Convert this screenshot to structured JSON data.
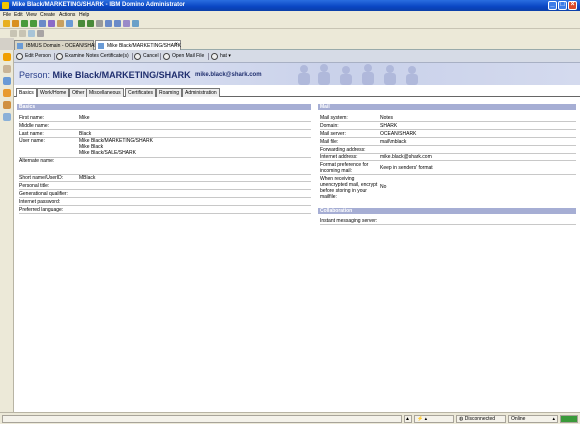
{
  "window": {
    "title": "Mike Black/MARKETING/SHARK - IBM Domino Administrator"
  },
  "menu": [
    "File",
    "Edit",
    "View",
    "Create",
    "Actions",
    "Help"
  ],
  "tabs": [
    {
      "label": "IBMUS Domain - OCEAN/SHARK",
      "active": false
    },
    {
      "label": "Mike Black/MARKETING/SHARK",
      "active": true
    }
  ],
  "actions": {
    "edit": "Edit Person",
    "examine": "Examine Notes Certificate(s)",
    "cancel": "Cancel",
    "openmail": "Open Mail File",
    "more": "hat"
  },
  "person": {
    "prefix": "Person:",
    "name": "Mike Black/MARKETING/SHARK",
    "email": "mike.black@shark.com"
  },
  "form_tabs": [
    "Basics",
    "Work/Home",
    "Other",
    "Miscellaneous",
    "Certificates",
    "Roaming",
    "Administration"
  ],
  "basics": {
    "title": "Basics",
    "first_name": {
      "label": "First name:",
      "value": "Mike"
    },
    "middle_name": {
      "label": "Middle name:",
      "value": ""
    },
    "last_name": {
      "label": "Last name:",
      "value": "Black"
    },
    "user_name": {
      "label": "User name:",
      "values": [
        "Mike Black/MARKETING/SHARK",
        "Mike Black",
        "Mike Black/SALE/SHARK"
      ]
    },
    "alternate_name": {
      "label": "Alternate name:",
      "value": ""
    },
    "short_name": {
      "label": "Short name/UserID:",
      "value": "MBlack"
    },
    "personal_title": {
      "label": "Personal title:",
      "value": ""
    },
    "generational": {
      "label": "Generational qualifier:",
      "value": ""
    },
    "internet_password": {
      "label": "Internet password:",
      "value": ""
    },
    "preferred_language": {
      "label": "Preferred language:",
      "value": ""
    }
  },
  "mail": {
    "title": "Mail",
    "mail_system": {
      "label": "Mail system:",
      "value": "Notes"
    },
    "domain": {
      "label": "Domain:",
      "value": "SHARK"
    },
    "mail_server": {
      "label": "Mail server:",
      "value": "OCEAN/SHARK"
    },
    "mail_file": {
      "label": "Mail file:",
      "value": "mail\\mblack"
    },
    "forwarding": {
      "label": "Forwarding address:",
      "value": ""
    },
    "internet_address": {
      "label": "Internet address:",
      "value": "mike.black@shark.com"
    },
    "format_pref": {
      "label_lines": [
        "Format preference for",
        "incoming mail:"
      ],
      "value": "Keep in senders' format"
    },
    "encrypt": {
      "label_lines": [
        "When receiving",
        "unencrypted mail, encrypt",
        "before storing in your",
        "mailfile:"
      ],
      "value": "No"
    }
  },
  "collaboration": {
    "title": "Collaboration",
    "im_server": {
      "label": "Instant messaging server:",
      "value": ""
    }
  },
  "status": {
    "connection": "Disconnected",
    "location": "Online"
  }
}
